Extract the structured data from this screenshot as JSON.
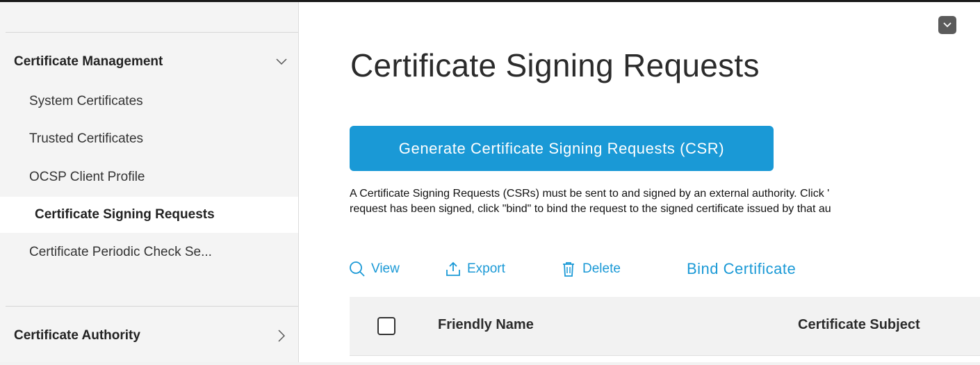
{
  "sidebar": {
    "groups": [
      {
        "label": "Certificate Management",
        "chevron": "chevron-down-icon"
      },
      {
        "label": "Certificate Authority",
        "chevron": "chevron-right-icon"
      }
    ],
    "items": [
      {
        "label": "System Certificates"
      },
      {
        "label": "Trusted Certificates"
      },
      {
        "label": "OCSP Client Profile"
      },
      {
        "label": "Certificate Signing Requests",
        "active": true
      },
      {
        "label": "Certificate Periodic Check Se..."
      }
    ]
  },
  "main": {
    "title": "Certificate Signing Requests",
    "generate_button": "Generate Certificate Signing Requests (CSR)",
    "description": [
      "A Certificate Signing Requests (CSRs) must be sent to and signed by an external authority. Click '",
      "request has been signed, click \"bind\" to bind the request to the signed certificate issued by that au"
    ],
    "toolbar": {
      "view": "View",
      "export": "Export",
      "delete": "Delete",
      "bind": "Bind Certificate"
    },
    "table": {
      "columns": [
        "Friendly Name",
        "Certificate Subject"
      ]
    }
  },
  "colors": {
    "accent": "#1a99d6",
    "sidebar_bg": "#f4f4f4",
    "active_item_bg": "#ffffff"
  }
}
